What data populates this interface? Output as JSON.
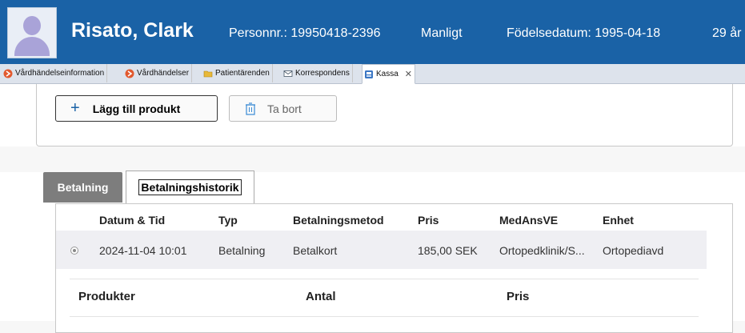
{
  "header": {
    "patient_name": "Risato, Clark",
    "personnr": "Personnr.: 19950418-2396",
    "gender": "Manligt",
    "birthdate": "Födelsedatum: 1995-04-18",
    "age": "29 år"
  },
  "tabs": [
    {
      "label": "Vårdhändelseinformation",
      "icon": "red-record-icon"
    },
    {
      "label": "Vårdhändelser",
      "icon": "red-record-icon"
    },
    {
      "label": "Patientärenden",
      "icon": "folder-icon"
    },
    {
      "label": "Korrespondens",
      "icon": "envelope-icon"
    },
    {
      "label": "Kassa",
      "icon": "cash-register-icon"
    }
  ],
  "toolbar": {
    "add_label": "Lägg till produkt",
    "delete_label": "Ta bort"
  },
  "payment_tabs": {
    "payment": "Betalning",
    "history": "Betalningshistorik"
  },
  "history_table": {
    "columns": [
      "Datum & Tid",
      "Typ",
      "Betalningsmetod",
      "Pris",
      "MedAnsVE",
      "Enhet"
    ],
    "rows": [
      [
        "2024-11-04 10:01",
        "Betalning",
        "Betalkort",
        "185,00 SEK",
        "Ortopedklinik/S...",
        "Ortopediavd"
      ]
    ]
  },
  "products_table": {
    "columns": [
      "Produkter",
      "Antal",
      "Pris"
    ]
  },
  "colors": {
    "header_bg": "#1a62a6",
    "active_tab_bg": "#7d7d7d"
  }
}
